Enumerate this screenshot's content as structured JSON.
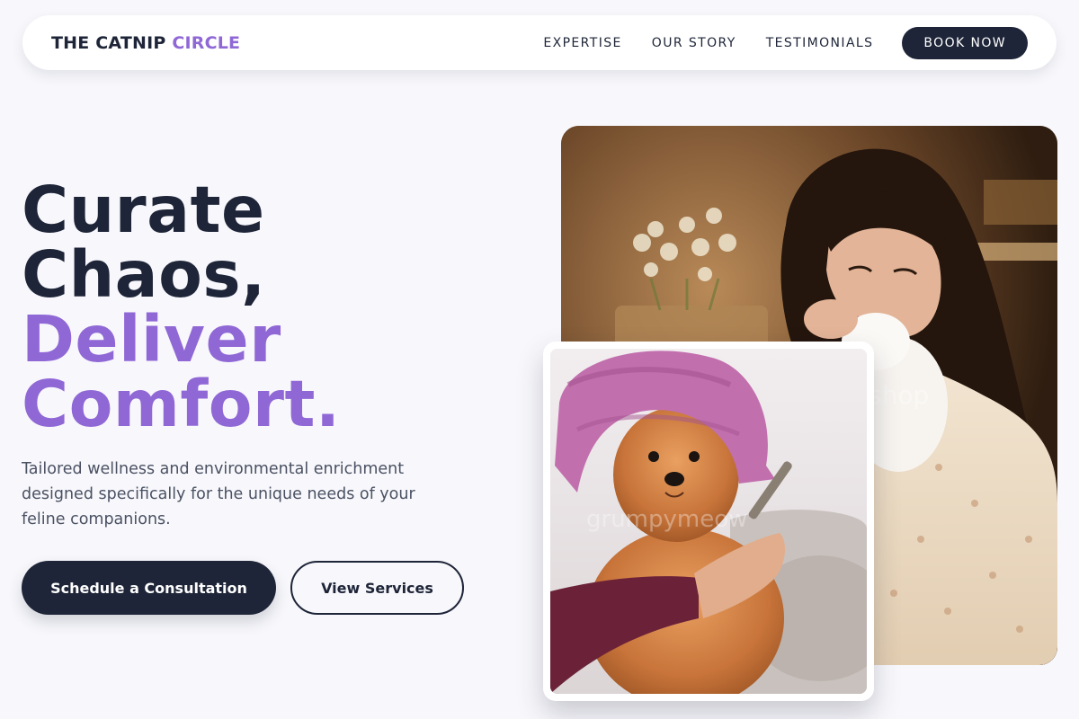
{
  "brand": {
    "name": "THE CATNIP",
    "accent": "CIRCLE"
  },
  "nav": {
    "links": [
      "EXPERTISE",
      "OUR STORY",
      "TESTIMONIALS"
    ],
    "cta": "BOOK NOW"
  },
  "hero": {
    "title_line1": "Curate",
    "title_line2": "Chaos,",
    "title_line3": "Deliver",
    "title_line4": "Comfort.",
    "subtitle": "Tailored wellness and environmental enrichment designed specifically for the unique needs of your feline companions.",
    "primary_button": "Schedule a Consultation",
    "secondary_button": "View Services"
  },
  "images": {
    "main_watermark": "shop",
    "card_watermark": "grumpymeow"
  },
  "colors": {
    "navy": "#1e2538",
    "accent_purple": "#9068d6",
    "background": "#f8f8fc"
  }
}
